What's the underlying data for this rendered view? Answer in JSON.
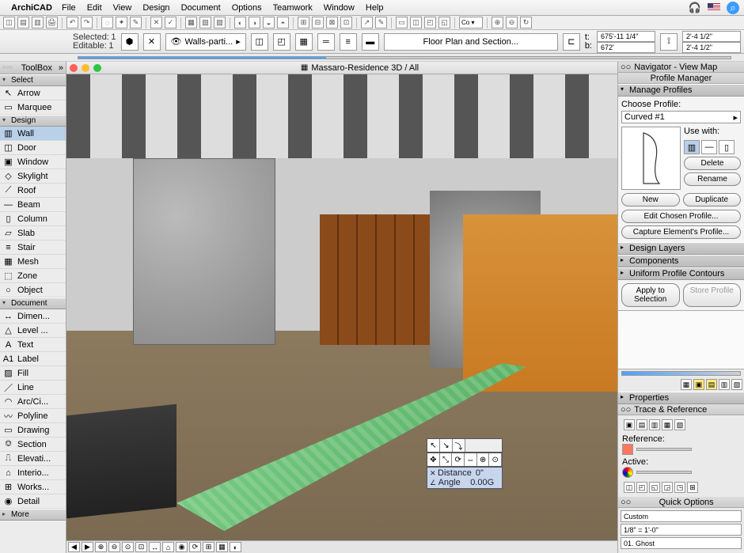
{
  "menubar": {
    "app": "ArchiCAD",
    "items": [
      "File",
      "Edit",
      "View",
      "Design",
      "Document",
      "Options",
      "Teamwork",
      "Window",
      "Help"
    ]
  },
  "infobar": {
    "selected_label": "Selected:",
    "selected_count": "1",
    "editable_label": "Editable:",
    "editable_count": "1",
    "layer_filter": "Walls-parti...",
    "plan_button": "Floor Plan and Section...",
    "coord_t_label": "t:",
    "coord_t": "675'-11 1/4\"",
    "coord_b_label": "b:",
    "coord_b": "672'",
    "dim1": "2'-4 1/2\"",
    "dim2": "2'-4 1/2\""
  },
  "toolbox": {
    "title": "ToolBox",
    "sections": {
      "select": "Select",
      "design": "Design",
      "document": "Document",
      "more": "More"
    },
    "select_items": [
      {
        "icon": "↖",
        "label": "Arrow"
      },
      {
        "icon": "▭",
        "label": "Marquee"
      }
    ],
    "design_items": [
      {
        "icon": "▥",
        "label": "Wall",
        "sel": true
      },
      {
        "icon": "◫",
        "label": "Door"
      },
      {
        "icon": "▣",
        "label": "Window"
      },
      {
        "icon": "◇",
        "label": "Skylight"
      },
      {
        "icon": "⟋",
        "label": "Roof"
      },
      {
        "icon": "—",
        "label": "Beam"
      },
      {
        "icon": "▯",
        "label": "Column"
      },
      {
        "icon": "▱",
        "label": "Slab"
      },
      {
        "icon": "≡",
        "label": "Stair"
      },
      {
        "icon": "▦",
        "label": "Mesh"
      },
      {
        "icon": "⬚",
        "label": "Zone"
      },
      {
        "icon": "○",
        "label": "Object"
      }
    ],
    "document_items": [
      {
        "icon": "↔",
        "label": "Dimen..."
      },
      {
        "icon": "△",
        "label": "Level ..."
      },
      {
        "icon": "A",
        "label": "Text"
      },
      {
        "icon": "A1",
        "label": "Label"
      },
      {
        "icon": "▨",
        "label": "Fill"
      },
      {
        "icon": "／",
        "label": "Line"
      },
      {
        "icon": "◠",
        "label": "Arc/Ci..."
      },
      {
        "icon": "〰",
        "label": "Polyline"
      },
      {
        "icon": "▭",
        "label": "Drawing"
      },
      {
        "icon": "⎊",
        "label": "Section"
      },
      {
        "icon": "⎍",
        "label": "Elevati..."
      },
      {
        "icon": "⌂",
        "label": "Interio..."
      },
      {
        "icon": "⊞",
        "label": "Works..."
      },
      {
        "icon": "◉",
        "label": "Detail"
      }
    ]
  },
  "document": {
    "title": "Massaro-Residence 3D / All"
  },
  "picker": {
    "distance_label": "Distance",
    "distance": "0\"",
    "angle_label": "Angle",
    "angle": "0.00G"
  },
  "navigator": {
    "tab": "Navigator - View Map",
    "subtab": "Profile Manager",
    "manage_profiles": "Manage Profiles",
    "choose_label": "Choose Profile:",
    "profile": "Curved #1",
    "usewith": "Use with:",
    "buttons": {
      "delete": "Delete",
      "rename": "Rename",
      "new": "New",
      "duplicate": "Duplicate",
      "edit": "Edit Chosen Profile...",
      "capture": "Capture Element's Profile..."
    },
    "groups": {
      "layers": "Design Layers",
      "components": "Components",
      "contours": "Uniform Profile Contours"
    },
    "apply": "Apply to Selection",
    "store": "Store Profile",
    "properties": "Properties",
    "trace": "Trace & Reference",
    "ref_label": "Reference:",
    "active_label": "Active:",
    "quick": "Quick Options",
    "q1": "Custom",
    "q2": "1/8\" = 1'-0\"",
    "q3": "01. Ghost"
  }
}
